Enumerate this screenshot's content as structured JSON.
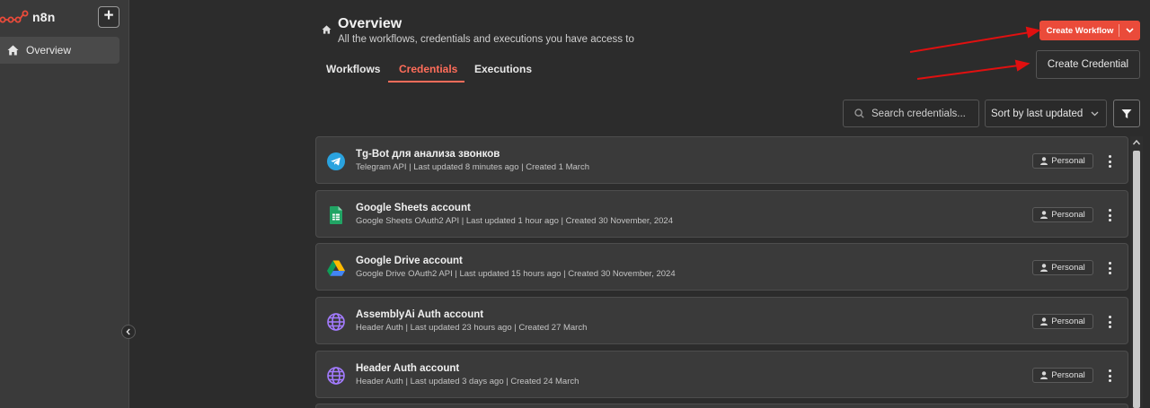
{
  "app": {
    "name": "n8n",
    "accent": "#ea4b3a"
  },
  "sidebar": {
    "add_label": "+",
    "items": [
      {
        "label": "Overview",
        "icon": "home-icon",
        "active": true
      }
    ]
  },
  "header": {
    "title": "Overview",
    "subtitle": "All the workflows, credentials and executions you have access to"
  },
  "tabs": [
    {
      "label": "Workflows",
      "active": false
    },
    {
      "label": "Credentials",
      "active": true
    },
    {
      "label": "Executions",
      "active": false
    }
  ],
  "actions": {
    "create_workflow_label": "Create Workflow",
    "dropdown_items": [
      "Create Credential"
    ]
  },
  "toolbar": {
    "search_placeholder": "Search credentials...",
    "sort_label": "Sort by last updated"
  },
  "credentials": [
    {
      "name": "Tg-Bot для анализа звонков",
      "meta": "Telegram API | Last updated 8 minutes ago | Created 1 March",
      "icon": "telegram-icon",
      "owner": "Personal"
    },
    {
      "name": "Google Sheets account",
      "meta": "Google Sheets OAuth2 API | Last updated 1 hour ago | Created 30 November, 2024",
      "icon": "google-sheets-icon",
      "owner": "Personal"
    },
    {
      "name": "Google Drive account",
      "meta": "Google Drive OAuth2 API | Last updated 15 hours ago | Created 30 November, 2024",
      "icon": "google-drive-icon",
      "owner": "Personal"
    },
    {
      "name": "AssemblyAi Auth account",
      "meta": "Header Auth | Last updated 23 hours ago | Created 27 March",
      "icon": "globe-icon",
      "owner": "Personal"
    },
    {
      "name": "Header Auth account",
      "meta": "Header Auth | Last updated 3 days ago | Created 24 March",
      "icon": "globe-icon",
      "owner": "Personal"
    }
  ]
}
